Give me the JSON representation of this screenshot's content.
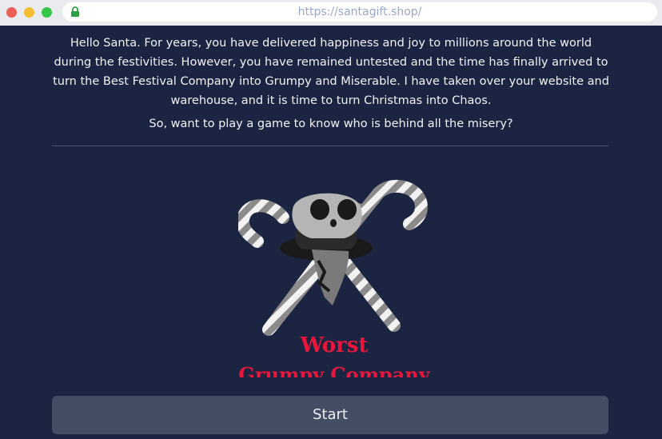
{
  "browser": {
    "url": "https://santagift.shop/",
    "colors": {
      "close": "#ee5f58",
      "minimize": "#f4bd33",
      "maximize": "#35c64a",
      "lock": "#2ea043"
    }
  },
  "intro": {
    "message": "Hello Santa. For years, you have delivered happiness and joy to millions around the world during the festivities. However, you have remained untested and the time has finally arrived to turn the Best Festival Company into Grumpy and Miserable. I have taken over your website and warehouse, and it is time to turn Christmas into Chaos.",
    "question": "So, want to play a game to know who is behind all the misery?"
  },
  "logo": {
    "line1": "Worst",
    "line2": "Grumpy Company",
    "text_color": "#e8163c",
    "icon": "skull-candy-canes-icon"
  },
  "actions": {
    "start_label": "Start"
  }
}
